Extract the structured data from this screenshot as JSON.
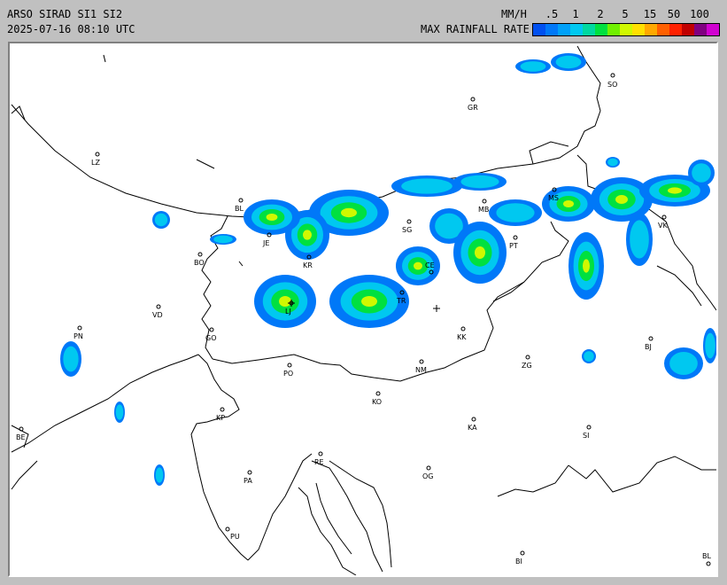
{
  "header": {
    "title": "ARSO SIRAD SI1 SI2",
    "timestamp": "2025-07-16 08:10 UTC",
    "unit": "MM/H",
    "legend_label": "MAX RAINFALL RATE"
  },
  "legend": {
    "ticks": [
      ".5",
      "1",
      "2",
      "5",
      "15",
      "50",
      "100"
    ],
    "colors": [
      "#0050f0",
      "#0078f8",
      "#00a0f8",
      "#00c8f0",
      "#00d8a0",
      "#00e040",
      "#70f000",
      "#d0f800",
      "#ffe000",
      "#ffa800",
      "#ff6000",
      "#ff2000",
      "#c00000",
      "#800080",
      "#d000d0"
    ]
  },
  "map": {
    "cities": [
      {
        "code": "SO"
      },
      {
        "code": "GR"
      },
      {
        "code": "LZ"
      },
      {
        "code": "BL"
      },
      {
        "code": "JE"
      },
      {
        "code": "BO"
      },
      {
        "code": "KR"
      },
      {
        "code": "SG"
      },
      {
        "code": "CE"
      },
      {
        "code": "MB"
      },
      {
        "code": "MS"
      },
      {
        "code": "PT"
      },
      {
        "code": "VK"
      },
      {
        "code": "VD"
      },
      {
        "code": "LJ"
      },
      {
        "code": "TR"
      },
      {
        "code": "PN"
      },
      {
        "code": "GO"
      },
      {
        "code": "KK"
      },
      {
        "code": "PO"
      },
      {
        "code": "NM"
      },
      {
        "code": "ZG"
      },
      {
        "code": "BJ"
      },
      {
        "code": "KP"
      },
      {
        "code": "KO"
      },
      {
        "code": "KA"
      },
      {
        "code": "SI"
      },
      {
        "code": "BE"
      },
      {
        "code": "RE"
      },
      {
        "code": "OG"
      },
      {
        "code": "PA"
      },
      {
        "code": "PU"
      },
      {
        "code": "BI"
      },
      {
        "code": "BL"
      }
    ]
  }
}
